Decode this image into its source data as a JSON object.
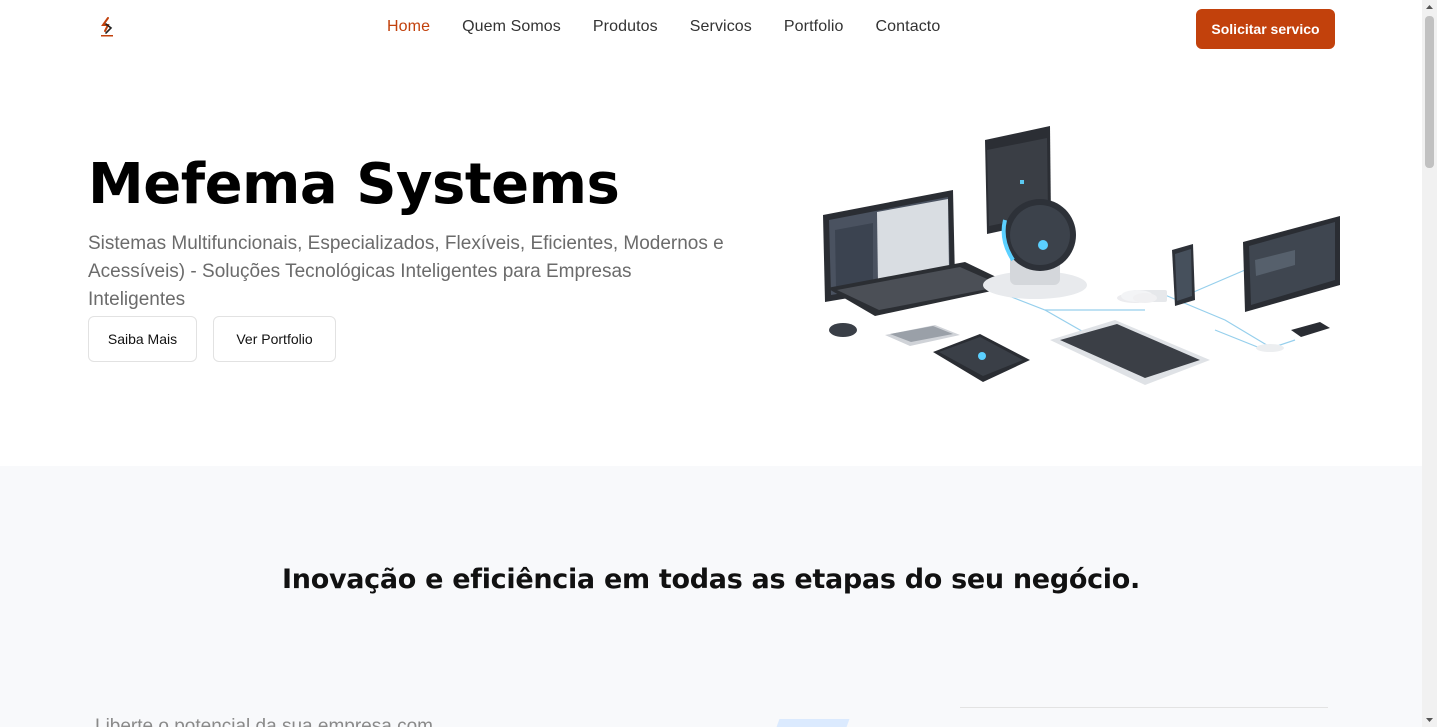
{
  "header": {
    "logo_icon": "mefema-logo-icon",
    "nav": [
      {
        "label": "Home",
        "active": true
      },
      {
        "label": "Quem Somos",
        "active": false
      },
      {
        "label": "Produtos",
        "active": false
      },
      {
        "label": "Servicos",
        "active": false
      },
      {
        "label": "Portfolio",
        "active": false
      },
      {
        "label": "Contacto",
        "active": false
      }
    ],
    "cta_label": "Solicitar servico"
  },
  "hero": {
    "title": "Mefema Systems",
    "subtitle": "Sistemas Multifuncionais, Especializados, Flexíveis, Eficientes, Modernos e Acessíveis) - Soluções Tecnológicas Inteligentes para Empresas Inteligentes",
    "buttons": {
      "primary": "Saiba Mais",
      "secondary": "Ver Portfolio"
    },
    "illustration": "connected-devices-illustration"
  },
  "section2": {
    "title": "Inovação e eficiência em todas as etapas do seu negócio.",
    "text": "Liberte o potencial da sua empresa com"
  },
  "colors": {
    "accent": "#c2410c",
    "section_bg": "#f8f9fb",
    "text_dark": "#111111",
    "text_muted": "#6b6b6b"
  }
}
